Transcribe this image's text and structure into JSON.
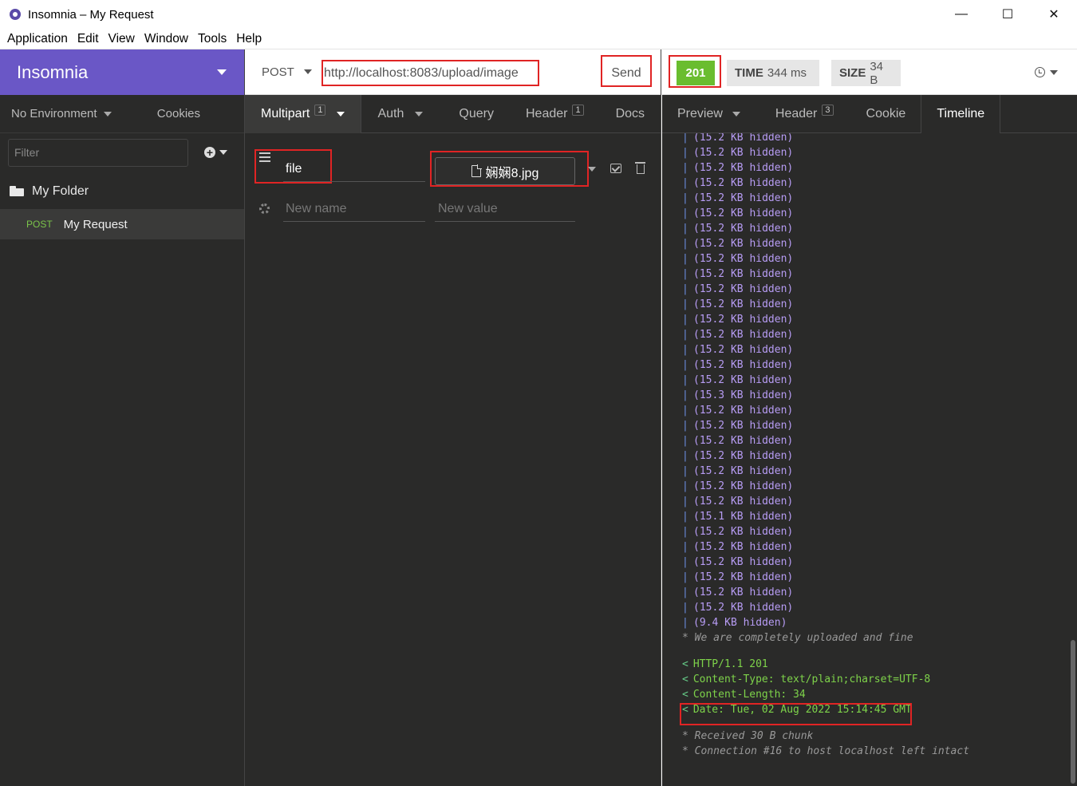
{
  "window": {
    "title": "Insomnia – My Request"
  },
  "menu": [
    "Application",
    "Edit",
    "View",
    "Window",
    "Tools",
    "Help"
  ],
  "sidebar": {
    "brand": "Insomnia",
    "environment": "No Environment",
    "cookies": "Cookies",
    "filter_placeholder": "Filter",
    "folder": "My Folder",
    "request": {
      "method": "POST",
      "name": "My Request"
    }
  },
  "request": {
    "method": "POST",
    "url": "http://localhost:8083/upload/image",
    "send": "Send",
    "tabs": [
      {
        "label": "Multipart",
        "badge": "1"
      },
      {
        "label": "Auth",
        "badge": ""
      },
      {
        "label": "Query",
        "badge": ""
      },
      {
        "label": "Header",
        "badge": "1"
      },
      {
        "label": "Docs",
        "badge": ""
      }
    ],
    "param": {
      "name": "file",
      "file": "娴娴8.jpg"
    },
    "new_name_placeholder": "New name",
    "new_value_placeholder": "New value"
  },
  "response": {
    "status": "201",
    "time_label": "TIME",
    "time_value": "344 ms",
    "size_label": "SIZE",
    "size_value": "34 B",
    "tabs": [
      {
        "label": "Preview",
        "badge": ""
      },
      {
        "label": "Header",
        "badge": "3"
      },
      {
        "label": "Cookie",
        "badge": ""
      },
      {
        "label": "Timeline",
        "badge": ""
      }
    ],
    "timeline": {
      "hidden_chunks": [
        "(15.2 KB hidden)",
        "(15.2 KB hidden)",
        "(15.2 KB hidden)",
        "(15.2 KB hidden)",
        "(15.2 KB hidden)",
        "(15.2 KB hidden)",
        "(15.2 KB hidden)",
        "(15.2 KB hidden)",
        "(15.2 KB hidden)",
        "(15.2 KB hidden)",
        "(15.2 KB hidden)",
        "(15.2 KB hidden)",
        "(15.2 KB hidden)",
        "(15.2 KB hidden)",
        "(15.2 KB hidden)",
        "(15.2 KB hidden)",
        "(15.2 KB hidden)",
        "(15.3 KB hidden)",
        "(15.2 KB hidden)",
        "(15.2 KB hidden)",
        "(15.2 KB hidden)",
        "(15.2 KB hidden)",
        "(15.2 KB hidden)",
        "(15.2 KB hidden)",
        "(15.2 KB hidden)",
        "(15.1 KB hidden)",
        "(15.2 KB hidden)",
        "(15.2 KB hidden)",
        "(15.2 KB hidden)",
        "(15.2 KB hidden)",
        "(15.2 KB hidden)",
        "(15.2 KB hidden)",
        "(9.4 KB hidden)"
      ],
      "upload_msg": "* We are completely uploaded and fine",
      "response_headers": [
        "HTTP/1.1 201",
        "Content-Type: text/plain;charset=UTF-8",
        "Content-Length: 34",
        "Date: Tue, 02 Aug 2022 15:14:45 GMT"
      ],
      "trailer": [
        "* Received 30 B chunk",
        "* Connection #16 to host localhost left intact"
      ]
    }
  }
}
